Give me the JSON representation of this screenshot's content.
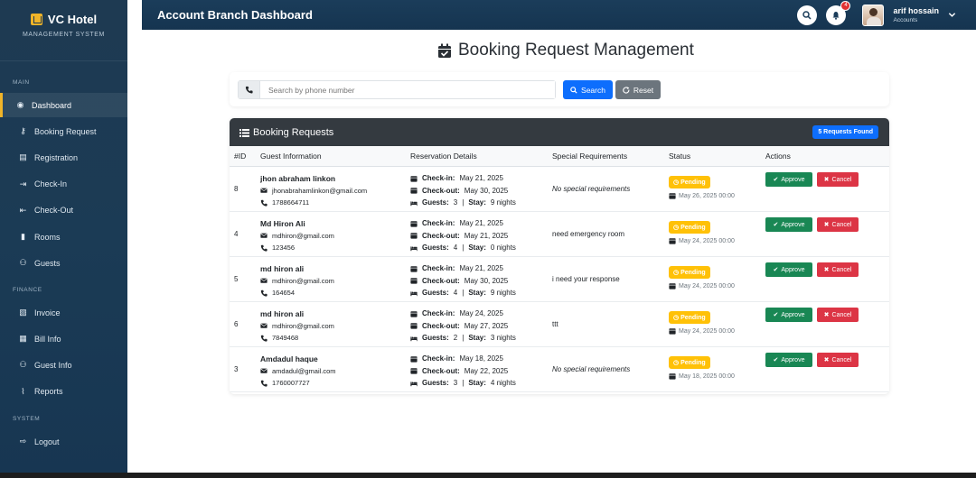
{
  "brand": {
    "title": "VC Hotel",
    "subtitle": "MANAGEMENT SYSTEM"
  },
  "sidebar": {
    "sections": [
      {
        "label": "MAIN",
        "items": [
          {
            "label": "Dashboard",
            "icon": "dashboard-icon",
            "active": true
          },
          {
            "label": "Booking Request",
            "icon": "key-icon"
          },
          {
            "label": "Registration",
            "icon": "id-card-icon"
          },
          {
            "label": "Check-In",
            "icon": "sign-in-icon"
          },
          {
            "label": "Check-Out",
            "icon": "sign-out-icon"
          },
          {
            "label": "Rooms",
            "icon": "door-icon"
          },
          {
            "label": "Guests",
            "icon": "users-icon"
          }
        ]
      },
      {
        "label": "FINANCE",
        "items": [
          {
            "label": "Invoice",
            "icon": "invoice-icon"
          },
          {
            "label": "Bill Info",
            "icon": "bill-icon"
          },
          {
            "label": "Guest Info",
            "icon": "users-icon"
          },
          {
            "label": "Reports",
            "icon": "chart-icon"
          }
        ]
      },
      {
        "label": "SYSTEM",
        "items": [
          {
            "label": "Logout",
            "icon": "logout-icon"
          }
        ]
      }
    ]
  },
  "header": {
    "title": "Account Branch Dashboard",
    "notifications": "4",
    "user": {
      "name": "arif hossain",
      "role": "Accounts"
    }
  },
  "page": {
    "heading": "Booking Request Management"
  },
  "search": {
    "placeholder": "Search by phone number",
    "search_label": "Search",
    "reset_label": "Reset"
  },
  "table": {
    "title": "Booking Requests",
    "found_badge": "5 Requests Found",
    "columns": [
      "#ID",
      "Guest Information",
      "Reservation Details",
      "Special Requirements",
      "Status",
      "Actions"
    ],
    "labels": {
      "check_in": "Check-in:",
      "check_out": "Check-out:",
      "guests": "Guests:",
      "stay": "Stay:",
      "approve": "Approve",
      "cancel": "Cancel"
    },
    "rows": [
      {
        "id": "8",
        "name": "jhon abraham linkon",
        "email": "jhonabrahamlinkon@gmail.com",
        "phone": "1788664711",
        "check_in": "May 21, 2025",
        "check_out": "May 30, 2025",
        "guests": "3",
        "stay": "9 nights",
        "special": "No special requirements",
        "special_italic": true,
        "status": "Pending",
        "date": "May 26, 2025 00:00"
      },
      {
        "id": "4",
        "name": "Md Hiron Ali",
        "email": "mdhiron@gmail.com",
        "phone": "123456",
        "check_in": "May 21, 2025",
        "check_out": "May 21, 2025",
        "guests": "4",
        "stay": "0 nights",
        "special": "need emergency room",
        "special_italic": false,
        "status": "Pending",
        "date": "May 24, 2025 00:00"
      },
      {
        "id": "5",
        "name": "md hiron ali",
        "email": "mdhiron@gmail.com",
        "phone": "164654",
        "check_in": "May 21, 2025",
        "check_out": "May 30, 2025",
        "guests": "4",
        "stay": "9 nights",
        "special": "i need your response",
        "special_italic": false,
        "status": "Pending",
        "date": "May 24, 2025 00:00"
      },
      {
        "id": "6",
        "name": "md hiron ali",
        "email": "mdhiron@gmail.com",
        "phone": "7849468",
        "check_in": "May 24, 2025",
        "check_out": "May 27, 2025",
        "guests": "2",
        "stay": "3 nights",
        "special": "ttt",
        "special_italic": false,
        "status": "Pending",
        "date": "May 24, 2025 00:00"
      },
      {
        "id": "3",
        "name": "Amdadul haque",
        "email": "amdadul@gmail.com",
        "phone": "1760007727",
        "check_in": "May 18, 2025",
        "check_out": "May 22, 2025",
        "guests": "3",
        "stay": "4 nights",
        "special": "No special requirements",
        "special_italic": true,
        "status": "Pending",
        "date": "May 18, 2025 00:00"
      }
    ]
  },
  "colors": {
    "sidebar": "#1e3a52",
    "accent": "#f0b429",
    "primary": "#0d6efd",
    "success": "#198754",
    "danger": "#dc3545",
    "warning": "#ffc107"
  }
}
